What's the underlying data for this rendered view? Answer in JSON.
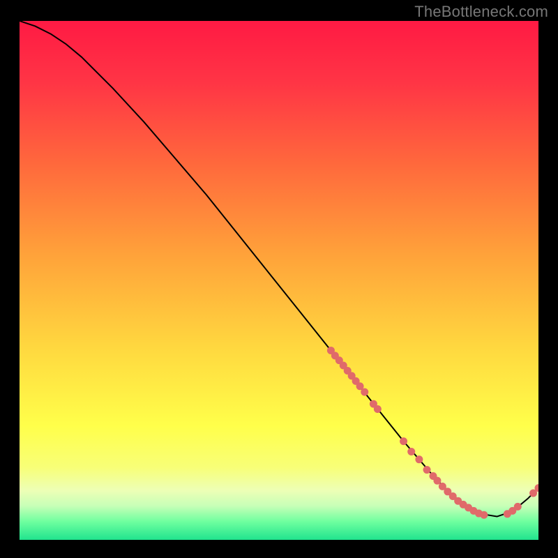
{
  "watermark": "TheBottleneck.com",
  "chart_data": {
    "type": "line",
    "title": "",
    "xlabel": "",
    "ylabel": "",
    "xlim": [
      0,
      100
    ],
    "ylim": [
      0,
      100
    ],
    "grid": false,
    "legend": false,
    "background_gradient": {
      "stops": [
        {
          "offset": 0.0,
          "color": "#ff1a44"
        },
        {
          "offset": 0.12,
          "color": "#ff3545"
        },
        {
          "offset": 0.28,
          "color": "#ff6a3c"
        },
        {
          "offset": 0.45,
          "color": "#ffa23a"
        },
        {
          "offset": 0.63,
          "color": "#ffd83f"
        },
        {
          "offset": 0.78,
          "color": "#ffff4a"
        },
        {
          "offset": 0.86,
          "color": "#f8ff77"
        },
        {
          "offset": 0.905,
          "color": "#edffb6"
        },
        {
          "offset": 0.935,
          "color": "#c6ffb7"
        },
        {
          "offset": 0.965,
          "color": "#6eff9f"
        },
        {
          "offset": 1.0,
          "color": "#20e38e"
        }
      ]
    },
    "series": [
      {
        "name": "curve",
        "stroke": "#000000",
        "stroke_width": 2,
        "x": [
          0,
          3,
          6,
          9,
          12,
          18,
          24,
          30,
          36,
          42,
          48,
          54,
          60,
          66,
          70,
          74,
          77,
          80,
          83,
          86,
          89,
          92,
          95,
          98,
          100
        ],
        "y": [
          100,
          99,
          97.5,
          95.5,
          93,
          87,
          80.5,
          73.5,
          66.5,
          59,
          51.5,
          44,
          36.5,
          29,
          24,
          19,
          15.5,
          12,
          9,
          6.5,
          5,
          4.5,
          5.5,
          8,
          10
        ]
      }
    ],
    "scatter": [
      {
        "name": "markers-descent",
        "fill": "#e06a6a",
        "r": 5.5,
        "points": [
          {
            "x": 60.0,
            "y": 36.5
          },
          {
            "x": 60.8,
            "y": 35.5
          },
          {
            "x": 61.6,
            "y": 34.6
          },
          {
            "x": 62.4,
            "y": 33.6
          },
          {
            "x": 63.2,
            "y": 32.6
          },
          {
            "x": 64.0,
            "y": 31.6
          },
          {
            "x": 64.8,
            "y": 30.6
          },
          {
            "x": 65.6,
            "y": 29.6
          },
          {
            "x": 66.5,
            "y": 28.5
          },
          {
            "x": 68.2,
            "y": 26.2
          },
          {
            "x": 69.0,
            "y": 25.2
          }
        ]
      },
      {
        "name": "markers-valley",
        "fill": "#e06a6a",
        "r": 5.5,
        "points": [
          {
            "x": 74.0,
            "y": 19.0
          },
          {
            "x": 75.5,
            "y": 17.0
          },
          {
            "x": 77.0,
            "y": 15.5
          },
          {
            "x": 78.5,
            "y": 13.5
          },
          {
            "x": 79.7,
            "y": 12.3
          },
          {
            "x": 80.5,
            "y": 11.4
          },
          {
            "x": 81.5,
            "y": 10.3
          },
          {
            "x": 82.5,
            "y": 9.3
          },
          {
            "x": 83.5,
            "y": 8.4
          },
          {
            "x": 84.5,
            "y": 7.5
          },
          {
            "x": 85.5,
            "y": 6.8
          },
          {
            "x": 86.5,
            "y": 6.2
          },
          {
            "x": 87.5,
            "y": 5.6
          },
          {
            "x": 88.5,
            "y": 5.1
          },
          {
            "x": 89.5,
            "y": 4.8
          }
        ]
      },
      {
        "name": "markers-upturn",
        "fill": "#e06a6a",
        "r": 5.5,
        "points": [
          {
            "x": 94.0,
            "y": 5.0
          },
          {
            "x": 95.0,
            "y": 5.6
          },
          {
            "x": 96.0,
            "y": 6.4
          },
          {
            "x": 99.0,
            "y": 9.0
          },
          {
            "x": 100.0,
            "y": 10.0
          }
        ]
      }
    ]
  }
}
